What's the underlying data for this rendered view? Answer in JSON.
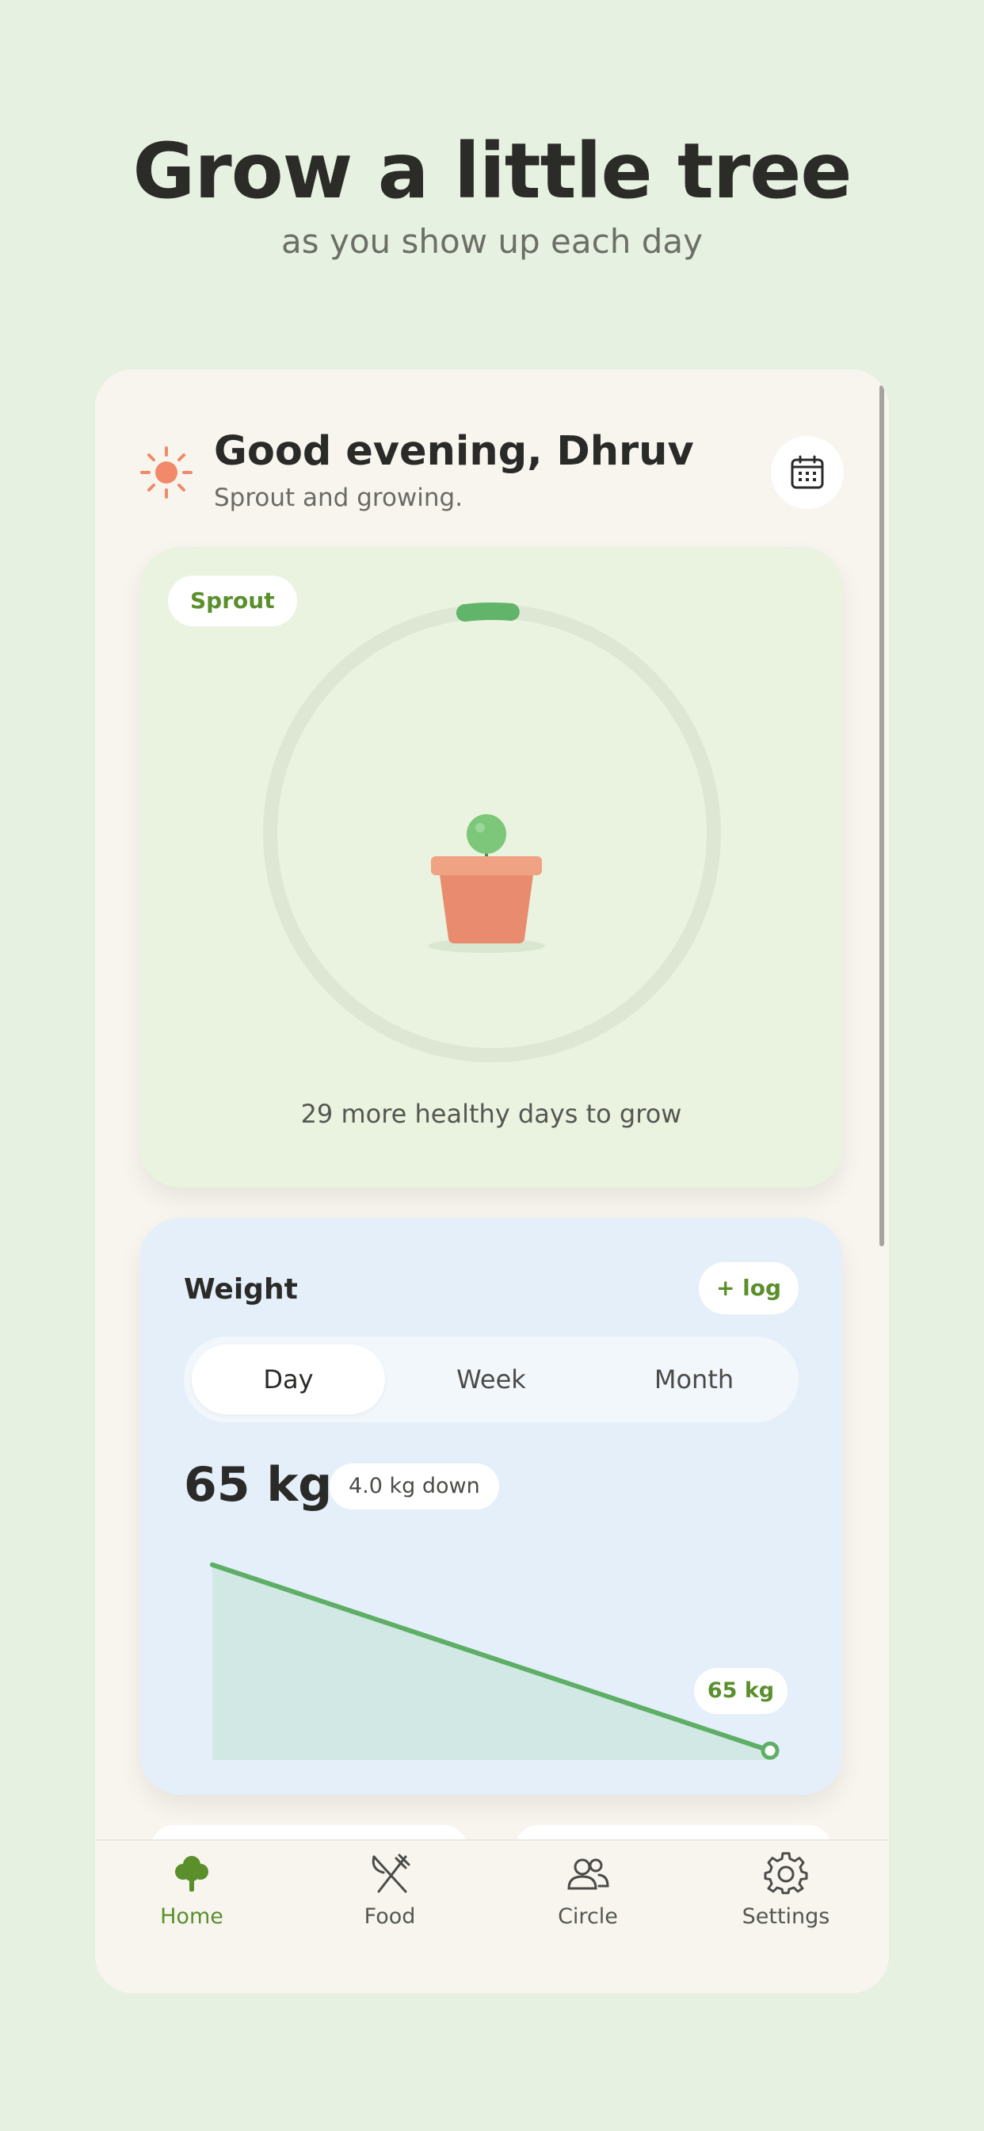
{
  "hero": {
    "title": "Grow a little tree",
    "subtitle": "as you show up each day"
  },
  "header": {
    "greeting": "Good evening, Dhruv",
    "subtitle": "Sprout and growing.",
    "icon": "sun-icon",
    "calendar_icon": "calendar-icon"
  },
  "tree": {
    "stage": "Sprout",
    "progress": 0.033,
    "message": "29 more healthy days to grow",
    "colors": {
      "ring_track": "#dde7d3",
      "ring_progress": "#62b46a",
      "pot": "#e98b6f",
      "plant": "#7cc77a"
    }
  },
  "weight": {
    "title": "Weight",
    "log_label": "+ log",
    "tabs": [
      "Day",
      "Week",
      "Month"
    ],
    "active_tab": "Day",
    "value": "65 kg",
    "delta": "4.0 kg down",
    "end_label": "65 kg"
  },
  "chart_data": {
    "type": "area",
    "x": [
      0,
      1
    ],
    "values": [
      69,
      65
    ],
    "ylim": [
      64.8,
      69.2
    ],
    "color": "#5fae67",
    "fill": "#d2e8e4",
    "end_label": "65 kg"
  },
  "nav": {
    "items": [
      {
        "label": "Home",
        "icon": "tree-icon",
        "active": true
      },
      {
        "label": "Food",
        "icon": "fork-knife-icon",
        "active": false
      },
      {
        "label": "Circle",
        "icon": "people-icon",
        "active": false
      },
      {
        "label": "Settings",
        "icon": "gear-icon",
        "active": false
      }
    ],
    "active_color": "#5a8f2c"
  }
}
